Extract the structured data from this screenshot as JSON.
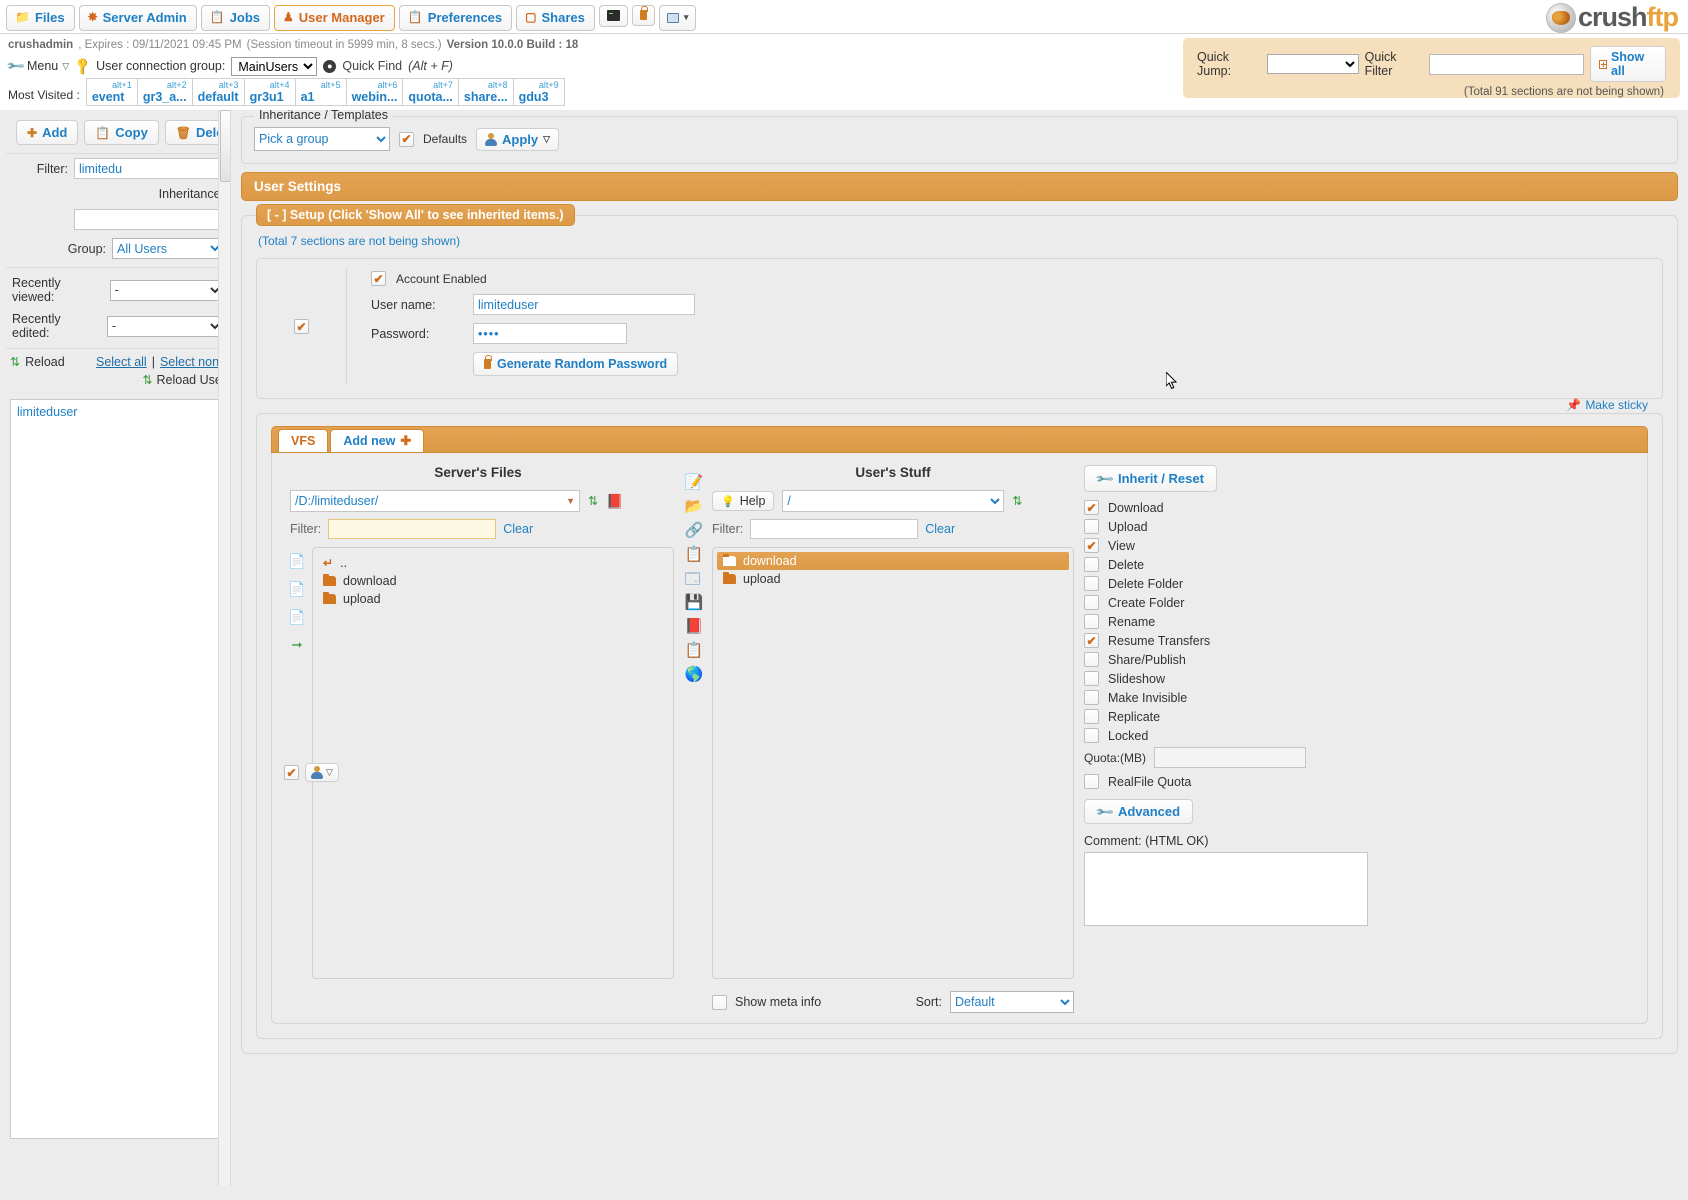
{
  "topnav": {
    "tabs": [
      {
        "label": "Files",
        "icon": "folder-icon",
        "active": false
      },
      {
        "label": "Server Admin",
        "icon": "gear-icon",
        "active": false
      },
      {
        "label": "Jobs",
        "icon": "clipboard-icon",
        "active": false
      },
      {
        "label": "User Manager",
        "icon": "user-icon",
        "active": true
      },
      {
        "label": "Preferences",
        "icon": "clipboard-icon",
        "active": false
      },
      {
        "label": "Shares",
        "icon": "book-icon",
        "active": false
      }
    ],
    "icon_buttons": [
      "terminal-icon",
      "lock-icon",
      "image-dropdown-icon"
    ],
    "logo_left": "crush",
    "logo_right": "ftp"
  },
  "session": {
    "user": "crushadmin",
    "expires": ", Expires : 09/11/2021 09:45 PM",
    "timeout": "(Session timeout in 5999 min, 8 secs.)",
    "version": "Version 10.0.0 Build : 18"
  },
  "menurow": {
    "menu_label": "Menu",
    "ucg_label": "User connection group:",
    "ucg_value": "MainUsers",
    "quickfind_label": "Quick Find",
    "quickfind_hint": "(Alt + F)"
  },
  "mostvisited": {
    "label": "Most Visited :",
    "items": [
      {
        "alt": "alt+1",
        "name": "event"
      },
      {
        "alt": "alt+2",
        "name": "gr3_a..."
      },
      {
        "alt": "alt+3",
        "name": "default"
      },
      {
        "alt": "alt+4",
        "name": "gr3u1"
      },
      {
        "alt": "alt+5",
        "name": "a1"
      },
      {
        "alt": "alt+6",
        "name": "webin..."
      },
      {
        "alt": "alt+7",
        "name": "quota..."
      },
      {
        "alt": "alt+8",
        "name": "share..."
      },
      {
        "alt": "alt+9",
        "name": "gdu3"
      }
    ]
  },
  "quickjump": {
    "jump_label": "Quick Jump:",
    "jump_value": "",
    "filter_label": "Quick Filter",
    "filter_value": "",
    "showall_label": "Show all",
    "note": "(Total 91 sections are not being shown)"
  },
  "sidebar": {
    "add_label": "Add",
    "copy_label": "Copy",
    "delete_label": "Delete",
    "filter_label": "Filter:",
    "filter_value": "limitedu",
    "inheritance_label": "Inheritance:",
    "inheritance_value": "",
    "group_label": "Group:",
    "group_value": "All Users",
    "recently_viewed_label": "Recently viewed:",
    "recently_viewed_value": "-",
    "recently_edited_label": "Recently edited:",
    "recently_edited_value": "-",
    "reload_label": "Reload",
    "select_all_label": "Select all",
    "separator": "|",
    "select_none_label": "Select none",
    "reload_user_label": "Reload User",
    "users": [
      "limiteduser"
    ]
  },
  "inheritance_panel": {
    "legend": "Inheritance / Templates",
    "pick_group_value": "Pick a group",
    "defaults_label": "Defaults",
    "defaults_checked": true,
    "apply_label": "Apply"
  },
  "user_settings": {
    "header": "User Settings",
    "setup_legend": "[ - ] Setup (Click 'Show All' to see inherited items.)",
    "not_shown": "(Total 7 sections are not being shown)",
    "section_checked": true,
    "account_enabled_label": "Account Enabled",
    "account_enabled_checked": true,
    "username_label": "User name:",
    "username_value": "limiteduser",
    "password_label": "Password:",
    "password_value": "••••",
    "generate_password_label": "Generate Random Password"
  },
  "vfs": {
    "make_sticky_label": "Make sticky",
    "tabs": [
      {
        "label": "VFS",
        "active": true
      },
      {
        "label": "Add new",
        "active": false
      }
    ],
    "server_panel": {
      "title": "Server's Files",
      "path_value": "/D:/limiteduser/",
      "filter_label": "Filter:",
      "filter_value": "",
      "clear_label": "Clear",
      "items": [
        {
          "name": "..",
          "type": "up"
        },
        {
          "name": "download",
          "type": "folder"
        },
        {
          "name": "upload",
          "type": "folder"
        }
      ],
      "checkbox_checked": true
    },
    "user_panel": {
      "title": "User's Stuff",
      "help_label": "Help",
      "path_value": "/",
      "filter_label": "Filter:",
      "filter_value": "",
      "clear_label": "Clear",
      "items": [
        {
          "name": "download",
          "type": "folder",
          "selected": true
        },
        {
          "name": "upload",
          "type": "folder",
          "selected": false
        }
      ]
    },
    "permissions": {
      "inherit_reset_label": "Inherit / Reset",
      "items": [
        {
          "label": "Download",
          "checked": true
        },
        {
          "label": "Upload",
          "checked": false
        },
        {
          "label": "View",
          "checked": true
        },
        {
          "label": "Delete",
          "checked": false
        },
        {
          "label": "Delete Folder",
          "checked": false
        },
        {
          "label": "Create Folder",
          "checked": false
        },
        {
          "label": "Rename",
          "checked": false
        },
        {
          "label": "Resume Transfers",
          "checked": true
        },
        {
          "label": "Share/Publish",
          "checked": false
        },
        {
          "label": "Slideshow",
          "checked": false
        },
        {
          "label": "Make Invisible",
          "checked": false
        },
        {
          "label": "Replicate",
          "checked": false
        },
        {
          "label": "Locked",
          "checked": false
        }
      ],
      "quota_label": "Quota:(MB)",
      "quota_value": "",
      "realfile_quota_label": "RealFile Quota",
      "realfile_quota_checked": false,
      "advanced_label": "Advanced",
      "comment_label": "Comment: (HTML OK)",
      "comment_value": ""
    },
    "bottom": {
      "show_meta_label": "Show meta info",
      "show_meta_checked": false,
      "sort_label": "Sort:",
      "sort_value": "Default"
    }
  },
  "colors": {
    "accent": "#dd9a46",
    "link": "#1f7fc4",
    "orange_text": "#cf6a1a"
  }
}
